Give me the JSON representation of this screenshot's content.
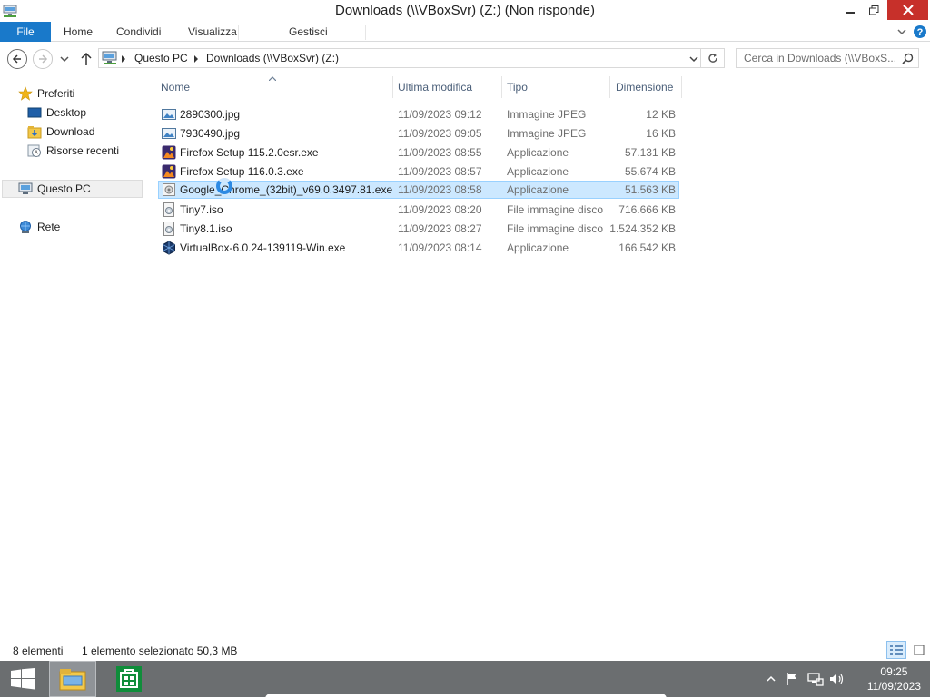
{
  "window": {
    "title": "Downloads (\\\\VBoxSvr) (Z:) (Non risponde)",
    "close_color": "#c7302a",
    "accent": "#1979ca"
  },
  "ribbon": {
    "tabs": [
      "File",
      "Home",
      "Condividi",
      "Visualizza",
      "Gestisci"
    ]
  },
  "address": {
    "crumbs": [
      "Questo PC",
      "Downloads (\\\\VBoxSvr) (Z:)"
    ],
    "search_placeholder": "Cerca in Downloads (\\\\VBoxS..."
  },
  "nav": {
    "favorites": "Preferiti",
    "desktop": "Desktop",
    "download": "Download",
    "recent": "Risorse recenti",
    "this_pc": "Questo PC",
    "network": "Rete"
  },
  "columns": {
    "name": "Nome",
    "modified": "Ultima modifica",
    "type": "Tipo",
    "size": "Dimensione"
  },
  "files": [
    {
      "name": "2890300.jpg",
      "modified": "11/09/2023 09:12",
      "type": "Immagine JPEG",
      "size": "12 KB",
      "icon": "image-icon"
    },
    {
      "name": "7930490.jpg",
      "modified": "11/09/2023 09:05",
      "type": "Immagine JPEG",
      "size": "16 KB",
      "icon": "image-icon"
    },
    {
      "name": "Firefox Setup 115.2.0esr.exe",
      "modified": "11/09/2023 08:55",
      "type": "Applicazione",
      "size": "57.131 KB",
      "icon": "firefox-icon"
    },
    {
      "name": "Firefox Setup 116.0.3.exe",
      "modified": "11/09/2023 08:57",
      "type": "Applicazione",
      "size": "55.674 KB",
      "icon": "firefox-icon"
    },
    {
      "name": "Google_Chrome_(32bit)_v69.0.3497.81.exe",
      "modified": "11/09/2023 08:58",
      "type": "Applicazione",
      "size": "51.563 KB",
      "icon": "installer-icon",
      "selected": true
    },
    {
      "name": "Tiny7.iso",
      "modified": "11/09/2023 08:20",
      "type": "File immagine disco",
      "size": "716.666 KB",
      "icon": "disc-image-icon"
    },
    {
      "name": "Tiny8.1.iso",
      "modified": "11/09/2023 08:27",
      "type": "File immagine disco",
      "size": "1.524.352 KB",
      "icon": "disc-image-icon"
    },
    {
      "name": "VirtualBox-6.0.24-139119-Win.exe",
      "modified": "11/09/2023 08:14",
      "type": "Applicazione",
      "size": "166.542 KB",
      "icon": "virtualbox-icon"
    }
  ],
  "status": {
    "count": "8 elementi",
    "selection": "1 elemento selezionato  50,3 MB"
  },
  "taskbar": {
    "time": "09:25",
    "date": "11/09/2023",
    "color": "#6b6e70"
  }
}
